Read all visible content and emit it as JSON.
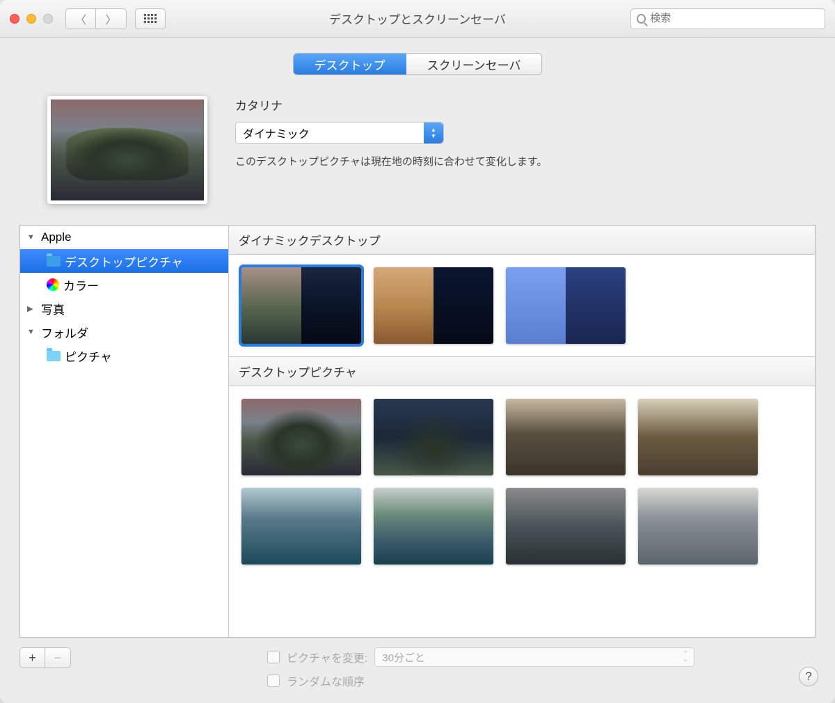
{
  "window": {
    "title": "デスクトップとスクリーンセーバ",
    "search_placeholder": "検索"
  },
  "tabs": {
    "desktop": "デスクトップ",
    "screensaver": "スクリーンセーバ",
    "active": "desktop"
  },
  "preview": {
    "name": "カタリナ",
    "mode": "ダイナミック",
    "description": "このデスクトップピクチャは現在地の時刻に合わせて変化します。"
  },
  "sidebar": {
    "apple": "Apple",
    "desktop_pictures": "デスクトップピクチャ",
    "colors": "カラー",
    "photos": "写真",
    "folders": "フォルダ",
    "pictures": "ピクチャ"
  },
  "gallery": {
    "section_dynamic": "ダイナミックデスクトップ",
    "section_pictures": "デスクトップピクチャ"
  },
  "footer": {
    "change_picture": "ピクチャを変更:",
    "interval": "30分ごと",
    "random": "ランダムな順序"
  }
}
